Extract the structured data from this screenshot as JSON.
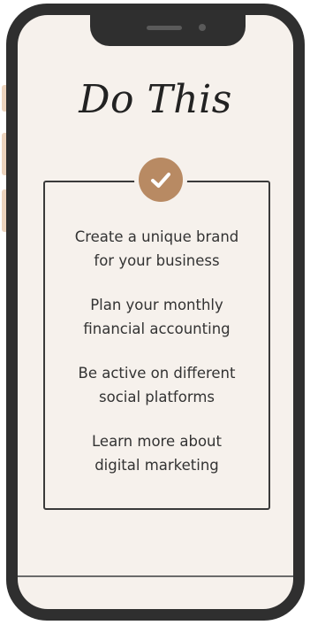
{
  "heading": "Do This",
  "check_icon": "checkmark-icon",
  "colors": {
    "phone_frame": "#2f2f2f",
    "screen_background": "#f6f1ec",
    "accent": "#b88a63",
    "side_buttons": "#ecd3bd",
    "text": "#333333"
  },
  "items": [
    {
      "line1": "Create a unique brand",
      "line2": "for your business"
    },
    {
      "line1": "Plan your monthly",
      "line2": "financial accounting"
    },
    {
      "line1": "Be active on different",
      "line2": "social platforms"
    },
    {
      "line1": "Learn more about",
      "line2": "digital marketing"
    }
  ]
}
